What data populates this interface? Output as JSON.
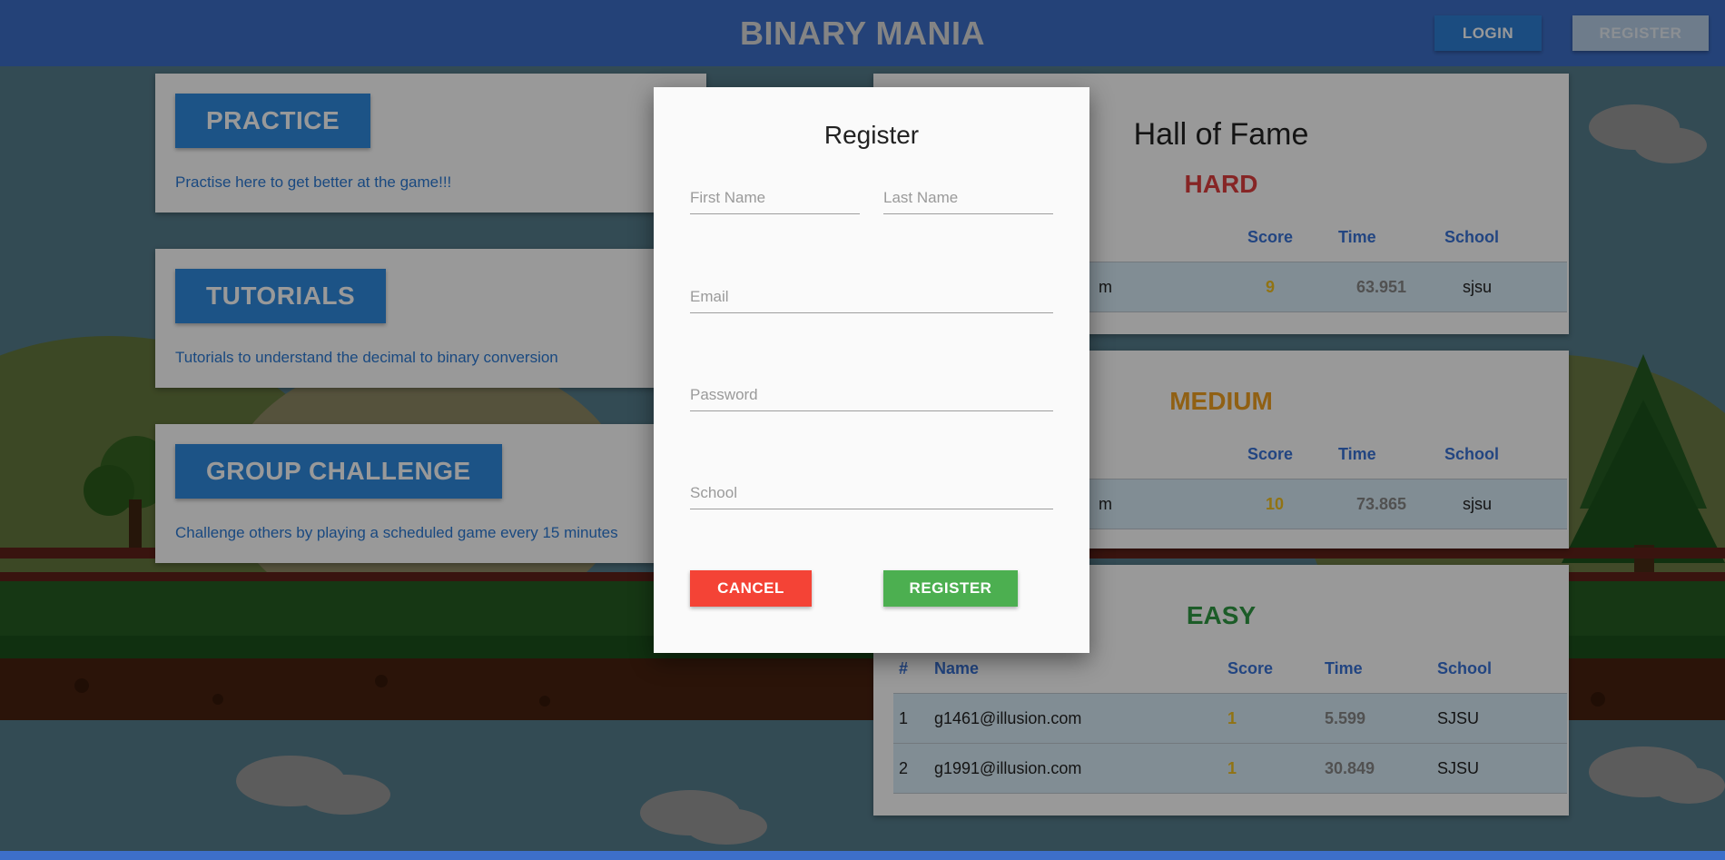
{
  "header": {
    "title": "BINARY MANIA",
    "login_label": "LOGIN",
    "register_label": "REGISTER"
  },
  "cards": [
    {
      "title": "PRACTICE",
      "description": "Practise here to get better at the game!!!"
    },
    {
      "title": "TUTORIALS",
      "description": "Tutorials to understand the decimal to binary conversion"
    },
    {
      "title": "GROUP CHALLENGE",
      "description": "Challenge others by playing a scheduled game every 15 minutes"
    }
  ],
  "hall_of_fame": {
    "title": "Hall of Fame",
    "columns": {
      "number": "#",
      "name": "Name",
      "score": "Score",
      "time": "Time",
      "school": "School"
    },
    "hard": {
      "label": "HARD",
      "rows": [
        {
          "name_fragment": "m",
          "score": "9",
          "time": "63.951",
          "school": "sjsu"
        }
      ]
    },
    "medium": {
      "label": "MEDIUM",
      "rows": [
        {
          "name_fragment": "m",
          "score": "10",
          "time": "73.865",
          "school": "sjsu"
        }
      ]
    },
    "easy": {
      "label": "EASY",
      "rows": [
        {
          "number": "1",
          "name": "g1461@illusion.com",
          "score": "1",
          "time": "5.599",
          "school": "SJSU"
        },
        {
          "number": "2",
          "name": "g1991@illusion.com",
          "score": "1",
          "time": "30.849",
          "school": "SJSU"
        }
      ]
    }
  },
  "modal": {
    "title": "Register",
    "first_name_placeholder": "First Name",
    "last_name_placeholder": "Last Name",
    "email_placeholder": "Email",
    "password_placeholder": "Password",
    "school_placeholder": "School",
    "cancel_label": "CANCEL",
    "register_label": "REGISTER"
  },
  "colors": {
    "header_blue": "#3d6fc9",
    "badge_blue": "#2f8be0",
    "cancel_red": "#f44336",
    "register_green": "#4caf50",
    "hard_red": "#e03e3e",
    "medium_orange": "#f0a020",
    "easy_green": "#2f9a44"
  }
}
